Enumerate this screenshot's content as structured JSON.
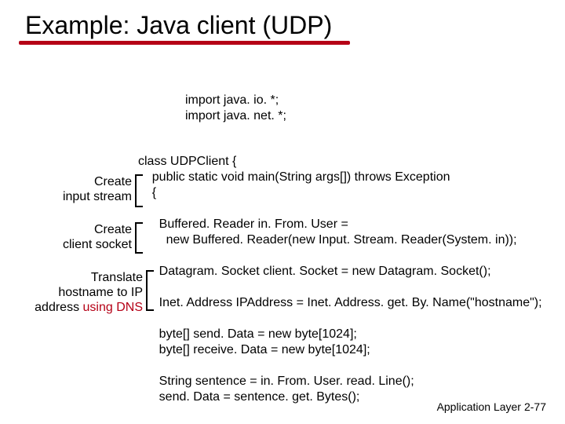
{
  "title": "Example: Java client (UDP)",
  "imports": {
    "line1": "import java. io. *;",
    "line2": "import java. net. *;"
  },
  "code": {
    "l1": "class UDPClient {",
    "l2": "    public static void main(String args[]) throws Exception",
    "l3": "    {",
    "l4": "",
    "l5": "      Buffered. Reader in. From. User =",
    "l6": "        new Buffered. Reader(new Input. Stream. Reader(System. in));",
    "l7": "",
    "l8": "      Datagram. Socket client. Socket = new Datagram. Socket();",
    "l9": "",
    "l10": "      Inet. Address IPAddress = Inet. Address. get. By. Name(\"hostname\");",
    "l11": "",
    "l12": "      byte[] send. Data = new byte[1024];",
    "l13": "      byte[] receive. Data = new byte[1024];",
    "l14": "",
    "l15": "      String sentence = in. From. User. read. Line();",
    "l16": "      send. Data = sentence. get. Bytes();"
  },
  "annotations": {
    "a1l1": "Create",
    "a1l2": "input stream",
    "a2l1": "Create",
    "a2l2": "client socket",
    "a3l1": "Translate",
    "a3l2": "hostname to IP",
    "a3l3a": "address ",
    "a3l3b": "using DNS"
  },
  "footer": {
    "label": "Application Layer",
    "page": "2-77"
  }
}
